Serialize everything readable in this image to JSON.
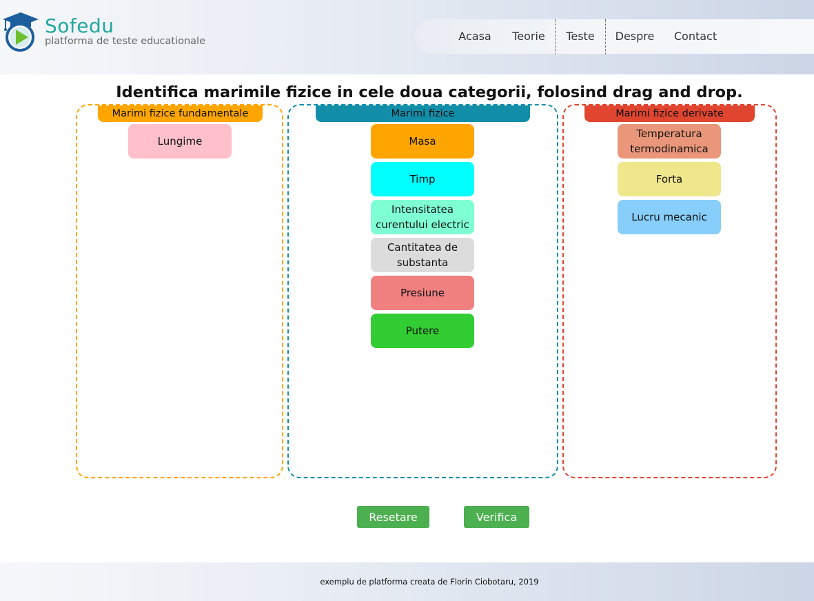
{
  "brand": {
    "name": "Sofedu",
    "tagline": "platforma de teste educationale"
  },
  "nav": [
    {
      "label": "Acasa"
    },
    {
      "label": "Teorie"
    },
    {
      "label": "Teste",
      "active": true
    },
    {
      "label": "Despre"
    },
    {
      "label": "Contact"
    }
  ],
  "title": "Identifica marimile fizice in cele doua categorii, folosind drag and drop.",
  "columns": {
    "fundamental": {
      "header": "Marimi fizice fundamentale",
      "accent": "#ffa500",
      "items": [
        {
          "label": "Lungime",
          "color": "#ffc0cb"
        }
      ]
    },
    "pool": {
      "header": "Marimi fizice",
      "accent": "#138ea8",
      "items": [
        {
          "label": "Masa",
          "color": "#ffa500"
        },
        {
          "label": "Timp",
          "color": "#00ffff"
        },
        {
          "label": "Intensitatea curentului electric",
          "color": "#7fffd4"
        },
        {
          "label": "Cantitatea de substanta",
          "color": "#dcdcdc"
        },
        {
          "label": "Presiune",
          "color": "#f08080"
        },
        {
          "label": "Putere",
          "color": "#32cd32"
        }
      ]
    },
    "derived": {
      "header": "Marimi fizice derivate",
      "accent": "#e04530",
      "items": [
        {
          "label": "Temperatura termodinamica",
          "color": "#e9967a"
        },
        {
          "label": "Forta",
          "color": "#f0e68c"
        },
        {
          "label": "Lucru mecanic",
          "color": "#87cefa"
        }
      ]
    }
  },
  "buttons": {
    "reset": "Resetare",
    "verify": "Verifica",
    "color": "#4caf50"
  },
  "footer": "exemplu de platforma creata de Florin Ciobotaru, 2019"
}
